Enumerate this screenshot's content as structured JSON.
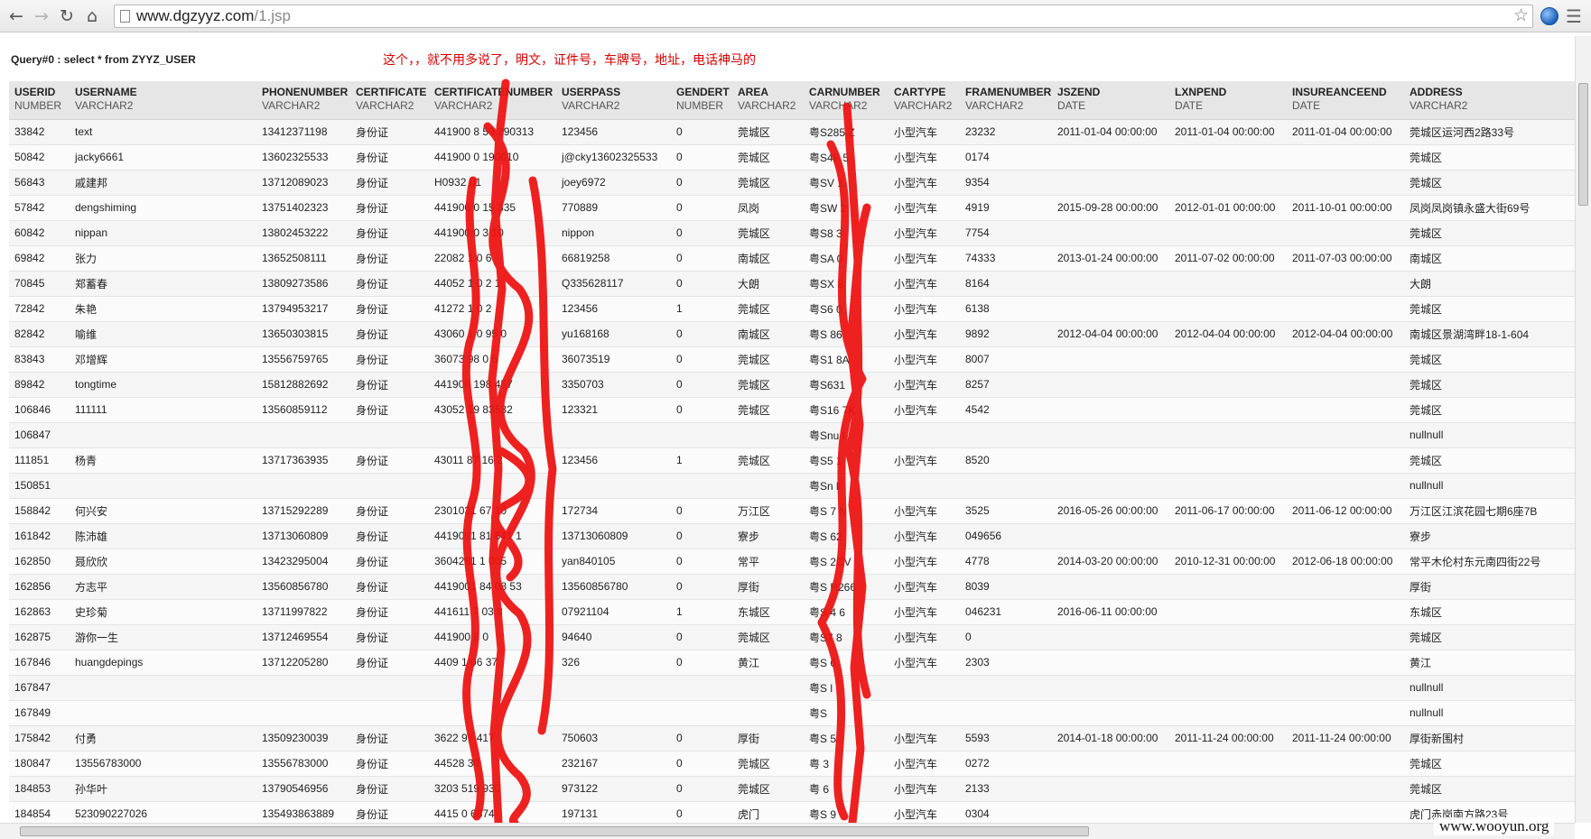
{
  "browser": {
    "url_host": "www.dgzyyz.com",
    "url_path": "/1.jsp"
  },
  "page": {
    "query_label": "Query#0 : select * from ZYYZ_USER",
    "annotation": "这个，，就不用多说了，明文，证件号，车牌号，地址，电话神马的",
    "watermark": "www.wooyun.org"
  },
  "table": {
    "columns": [
      {
        "name": "USERID",
        "type": "NUMBER"
      },
      {
        "name": "USERNAME",
        "type": "VARCHAR2"
      },
      {
        "name": "PHONENUMBER",
        "type": "VARCHAR2"
      },
      {
        "name": "CERTIFICATE",
        "type": "VARCHAR2"
      },
      {
        "name": "CERTIFICATENUMBER",
        "type": "VARCHAR2"
      },
      {
        "name": "USERPASS",
        "type": "VARCHAR2"
      },
      {
        "name": "GENDERT",
        "type": "NUMBER"
      },
      {
        "name": "AREA",
        "type": "VARCHAR2"
      },
      {
        "name": "CARNUMBER",
        "type": "VARCHAR2"
      },
      {
        "name": "CARTYPE",
        "type": "VARCHAR2"
      },
      {
        "name": "FRAMENUMBER",
        "type": "VARCHAR2"
      },
      {
        "name": "JSZEND",
        "type": "DATE"
      },
      {
        "name": "LXNPEND",
        "type": "DATE"
      },
      {
        "name": "INSUREANCEEND",
        "type": "DATE"
      },
      {
        "name": "ADDRESS",
        "type": "VARCHAR2"
      }
    ],
    "rows": [
      [
        "33842",
        "text",
        "13412371198",
        "身份证",
        "441900 8 50 290313",
        "123456",
        "0",
        "莞城区",
        "粤S285 Z",
        "小型汽车",
        "23232",
        "2011-01-04 00:00:00",
        "2011-01-04 00:00:00",
        "2011-01-04 00:00:00",
        "莞城区运河西2路33号"
      ],
      [
        "50842",
        "jacky6661",
        "13602325533",
        "身份证",
        "441900 0 190010",
        "j@cky13602325533",
        "0",
        "莞城区",
        "粤S4F 5",
        "小型汽车",
        "0174",
        "",
        "",
        "",
        "莞城区"
      ],
      [
        "56843",
        "戚建邦",
        "13712089023",
        "身份证",
        "H0932 01",
        "joey6972",
        "0",
        "莞城区",
        "粤SV 1",
        "小型汽车",
        "9354",
        "",
        "",
        "",
        "莞城区"
      ],
      [
        "57842",
        "dengshiming",
        "13751402323",
        "身份证",
        "441900 0 15 335",
        "770889",
        "0",
        "凤岗",
        "粤SW 2",
        "小型汽车",
        "4919",
        "2015-09-28 00:00:00",
        "2012-01-01 00:00:00",
        "2011-10-01 00:00:00",
        "凤岗凤岗镇永盛大街69号"
      ],
      [
        "60842",
        "nippan",
        "13802453222",
        "身份证",
        "441900 0 3 10",
        "nippon",
        "0",
        "莞城区",
        "粤S8 3",
        "小型汽车",
        "7754",
        "",
        "",
        "",
        "莞城区"
      ],
      [
        "69842",
        "张力",
        "13652508111",
        "身份证",
        "22082 1 0 6",
        "66819258",
        "0",
        "南城区",
        "粤SA 0",
        "小型汽车",
        "74333",
        "2013-01-24 00:00:00",
        "2011-07-02 00:00:00",
        "2011-07-03 00:00:00",
        "南城区"
      ],
      [
        "70845",
        "郑蓄春",
        "13809273586",
        "身份证",
        "44052 1 0 2 1",
        "Q335628117",
        "0",
        "大朗",
        "粤SX 8",
        "小型汽车",
        "8164",
        "",
        "",
        "",
        "大朗"
      ],
      [
        "72842",
        "朱艳",
        "13794953217",
        "身份证",
        "41272 1 0 2",
        "123456",
        "1",
        "莞城区",
        "粤S6 0",
        "小型汽车",
        "6138",
        "",
        "",
        "",
        "莞城区"
      ],
      [
        "82842",
        "喻维",
        "13650303815",
        "身份证",
        "43060 1 0 95 0",
        "yu168168",
        "0",
        "南城区",
        "粤S 86",
        "小型汽车",
        "9892",
        "2012-04-04 00:00:00",
        "2012-04-04 00:00:00",
        "2012-04-04 00:00:00",
        "南城区景湖湾畔18-1-604"
      ],
      [
        "83843",
        "邓增辉",
        "13556759765",
        "身份证",
        "36073 98 0 5",
        "36073519",
        "0",
        "莞城区",
        "粤S1 8A",
        "小型汽车",
        "8007",
        "",
        "",
        "",
        "莞城区"
      ],
      [
        "89842",
        "tongtime",
        "15812882692",
        "身份证",
        "441900 198 457",
        "3350703",
        "0",
        "莞城区",
        "粤S631",
        "小型汽车",
        "8257",
        "",
        "",
        "",
        "莞城区"
      ],
      [
        "106846",
        "111111",
        "13560859112",
        "身份证",
        "43052 19 83532",
        "123321",
        "0",
        "莞城区",
        "粤S16 7K",
        "小型汽车",
        "4542",
        "",
        "",
        "",
        "莞城区"
      ],
      [
        "106847",
        "",
        "",
        "",
        "",
        "",
        "",
        "",
        "粤Snu l",
        "",
        "",
        "",
        "",
        "",
        "nullnull"
      ],
      [
        "111851",
        "杨青",
        "13717363935",
        "身份证",
        "43011 87 16 2",
        "123456",
        "1",
        "莞城区",
        "粤S5 1",
        "小型汽车",
        "8520",
        "",
        "",
        "",
        "莞城区"
      ],
      [
        "150851",
        "",
        "",
        "",
        "",
        "",
        "",
        "",
        "粤Sn ll",
        "",
        "",
        "",
        "",
        "",
        "nullnull"
      ],
      [
        "158842",
        "何兴安",
        "13715292289",
        "身份证",
        "2301031 67 10",
        "172734",
        "0",
        "万江区",
        "粤S 7 N",
        "小型汽车",
        "3525",
        "2016-05-26 00:00:00",
        "2011-06-17 00:00:00",
        "2011-06-12 00:00:00",
        "万江区江滨花园七期6座7B"
      ],
      [
        "161842",
        "陈沛雄",
        "13713060809",
        "身份证",
        "4419001 81 641 1",
        "13713060809",
        "0",
        "寮步",
        "粤S 62",
        "小型汽车",
        "049656",
        "",
        "",
        "",
        "寮步"
      ],
      [
        "162850",
        "聂欣欣",
        "13423295004",
        "身份证",
        "3604281 1 005",
        "yan840105",
        "0",
        "常平",
        "粤S 2CV",
        "小型汽车",
        "4778",
        "2014-03-20 00:00:00",
        "2010-12-31 00:00:00",
        "2012-06-18 00:00:00",
        "常平木伦村东元南四街22号"
      ],
      [
        "162856",
        "方志平",
        "13560856780",
        "身份证",
        "4419001 84 08 53",
        "13560856780",
        "0",
        "厚街",
        "粤S R266",
        "小型汽车",
        "8039",
        "",
        "",
        "",
        "厚街"
      ],
      [
        "162863",
        "史珍菊",
        "13711997822",
        "身份证",
        "441611 7 03 8",
        "07921104",
        "1",
        "东城区",
        "粤S 4 6",
        "小型汽车",
        "046231",
        "2016-06-11 00:00:00",
        "",
        "",
        "东城区"
      ],
      [
        "162875",
        "游你一生",
        "13712469554",
        "身份证",
        "441900 8 0",
        "94640",
        "0",
        "莞城区",
        "粤S7 8",
        "小型汽车",
        "0",
        "",
        "",
        "",
        "莞城区"
      ],
      [
        "167846",
        "huangdepings",
        "13712205280",
        "身份证",
        "4409 1 06 37",
        "326",
        "0",
        "黄江",
        "粤S 6",
        "小型汽车",
        "2303",
        "",
        "",
        "",
        "黄江"
      ],
      [
        "167847",
        "",
        "",
        "",
        "",
        "",
        "",
        "",
        "粤S l",
        "",
        "",
        "",
        "",
        "",
        "nullnull"
      ],
      [
        "167849",
        "",
        "",
        "",
        "",
        "",
        "",
        "",
        "粤S",
        "",
        "",
        "",
        "",
        "",
        "nullnull"
      ],
      [
        "175842",
        "付勇",
        "13509230039",
        "身份证",
        "3622 97 417",
        "750603",
        "0",
        "厚街",
        "粤S 5",
        "小型汽车",
        "5593",
        "2014-01-18 00:00:00",
        "2011-11-24 00:00:00",
        "2011-11-24 00:00:00",
        "厚街新围村"
      ],
      [
        "180847",
        "13556783000",
        "13556783000",
        "身份证",
        "44528 30",
        "232167",
        "0",
        "莞城区",
        "粤 3",
        "小型汽车",
        "0272",
        "",
        "",
        "",
        "莞城区"
      ],
      [
        "184853",
        "孙华叶",
        "13790546956",
        "身份证",
        "3203 519 930",
        "973122",
        "0",
        "莞城区",
        "粤 6",
        "小型汽车",
        "2133",
        "",
        "",
        "",
        "莞城区"
      ],
      [
        "184854",
        "523090227026",
        "135493863889",
        "身份证",
        "4415 0 6874",
        "197131",
        "0",
        "虎门",
        "粤S 9",
        "小型汽车",
        "0304",
        "",
        "",
        "",
        "虎门赤岗南方路23号"
      ]
    ]
  }
}
